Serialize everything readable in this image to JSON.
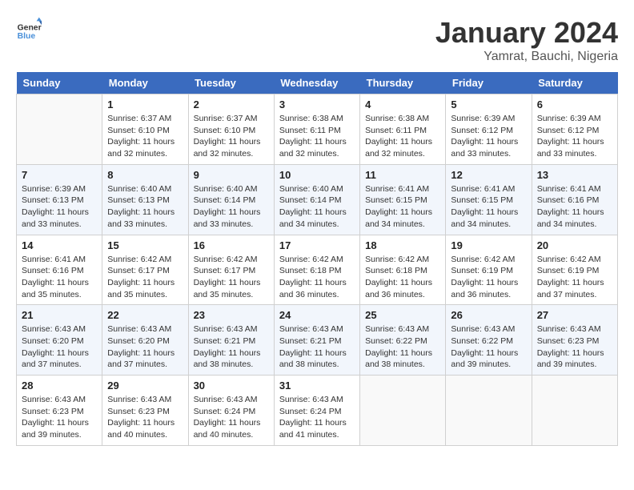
{
  "header": {
    "logo_line1": "General",
    "logo_line2": "Blue",
    "title": "January 2024",
    "subtitle": "Yamrat, Bauchi, Nigeria"
  },
  "weekdays": [
    "Sunday",
    "Monday",
    "Tuesday",
    "Wednesday",
    "Thursday",
    "Friday",
    "Saturday"
  ],
  "weeks": [
    [
      {
        "day": null
      },
      {
        "day": "1",
        "sunrise": "6:37 AM",
        "sunset": "6:10 PM",
        "daylight": "11 hours and 32 minutes."
      },
      {
        "day": "2",
        "sunrise": "6:37 AM",
        "sunset": "6:10 PM",
        "daylight": "11 hours and 32 minutes."
      },
      {
        "day": "3",
        "sunrise": "6:38 AM",
        "sunset": "6:11 PM",
        "daylight": "11 hours and 32 minutes."
      },
      {
        "day": "4",
        "sunrise": "6:38 AM",
        "sunset": "6:11 PM",
        "daylight": "11 hours and 32 minutes."
      },
      {
        "day": "5",
        "sunrise": "6:39 AM",
        "sunset": "6:12 PM",
        "daylight": "11 hours and 33 minutes."
      },
      {
        "day": "6",
        "sunrise": "6:39 AM",
        "sunset": "6:12 PM",
        "daylight": "11 hours and 33 minutes."
      }
    ],
    [
      {
        "day": "7",
        "sunrise": "6:39 AM",
        "sunset": "6:13 PM",
        "daylight": "11 hours and 33 minutes."
      },
      {
        "day": "8",
        "sunrise": "6:40 AM",
        "sunset": "6:13 PM",
        "daylight": "11 hours and 33 minutes."
      },
      {
        "day": "9",
        "sunrise": "6:40 AM",
        "sunset": "6:14 PM",
        "daylight": "11 hours and 33 minutes."
      },
      {
        "day": "10",
        "sunrise": "6:40 AM",
        "sunset": "6:14 PM",
        "daylight": "11 hours and 34 minutes."
      },
      {
        "day": "11",
        "sunrise": "6:41 AM",
        "sunset": "6:15 PM",
        "daylight": "11 hours and 34 minutes."
      },
      {
        "day": "12",
        "sunrise": "6:41 AM",
        "sunset": "6:15 PM",
        "daylight": "11 hours and 34 minutes."
      },
      {
        "day": "13",
        "sunrise": "6:41 AM",
        "sunset": "6:16 PM",
        "daylight": "11 hours and 34 minutes."
      }
    ],
    [
      {
        "day": "14",
        "sunrise": "6:41 AM",
        "sunset": "6:16 PM",
        "daylight": "11 hours and 35 minutes."
      },
      {
        "day": "15",
        "sunrise": "6:42 AM",
        "sunset": "6:17 PM",
        "daylight": "11 hours and 35 minutes."
      },
      {
        "day": "16",
        "sunrise": "6:42 AM",
        "sunset": "6:17 PM",
        "daylight": "11 hours and 35 minutes."
      },
      {
        "day": "17",
        "sunrise": "6:42 AM",
        "sunset": "6:18 PM",
        "daylight": "11 hours and 36 minutes."
      },
      {
        "day": "18",
        "sunrise": "6:42 AM",
        "sunset": "6:18 PM",
        "daylight": "11 hours and 36 minutes."
      },
      {
        "day": "19",
        "sunrise": "6:42 AM",
        "sunset": "6:19 PM",
        "daylight": "11 hours and 36 minutes."
      },
      {
        "day": "20",
        "sunrise": "6:42 AM",
        "sunset": "6:19 PM",
        "daylight": "11 hours and 37 minutes."
      }
    ],
    [
      {
        "day": "21",
        "sunrise": "6:43 AM",
        "sunset": "6:20 PM",
        "daylight": "11 hours and 37 minutes."
      },
      {
        "day": "22",
        "sunrise": "6:43 AM",
        "sunset": "6:20 PM",
        "daylight": "11 hours and 37 minutes."
      },
      {
        "day": "23",
        "sunrise": "6:43 AM",
        "sunset": "6:21 PM",
        "daylight": "11 hours and 38 minutes."
      },
      {
        "day": "24",
        "sunrise": "6:43 AM",
        "sunset": "6:21 PM",
        "daylight": "11 hours and 38 minutes."
      },
      {
        "day": "25",
        "sunrise": "6:43 AM",
        "sunset": "6:22 PM",
        "daylight": "11 hours and 38 minutes."
      },
      {
        "day": "26",
        "sunrise": "6:43 AM",
        "sunset": "6:22 PM",
        "daylight": "11 hours and 39 minutes."
      },
      {
        "day": "27",
        "sunrise": "6:43 AM",
        "sunset": "6:23 PM",
        "daylight": "11 hours and 39 minutes."
      }
    ],
    [
      {
        "day": "28",
        "sunrise": "6:43 AM",
        "sunset": "6:23 PM",
        "daylight": "11 hours and 39 minutes."
      },
      {
        "day": "29",
        "sunrise": "6:43 AM",
        "sunset": "6:23 PM",
        "daylight": "11 hours and 40 minutes."
      },
      {
        "day": "30",
        "sunrise": "6:43 AM",
        "sunset": "6:24 PM",
        "daylight": "11 hours and 40 minutes."
      },
      {
        "day": "31",
        "sunrise": "6:43 AM",
        "sunset": "6:24 PM",
        "daylight": "11 hours and 41 minutes."
      },
      {
        "day": null
      },
      {
        "day": null
      },
      {
        "day": null
      }
    ]
  ],
  "labels": {
    "sunrise_prefix": "Sunrise: ",
    "sunset_prefix": "Sunset: ",
    "daylight_prefix": "Daylight: "
  }
}
